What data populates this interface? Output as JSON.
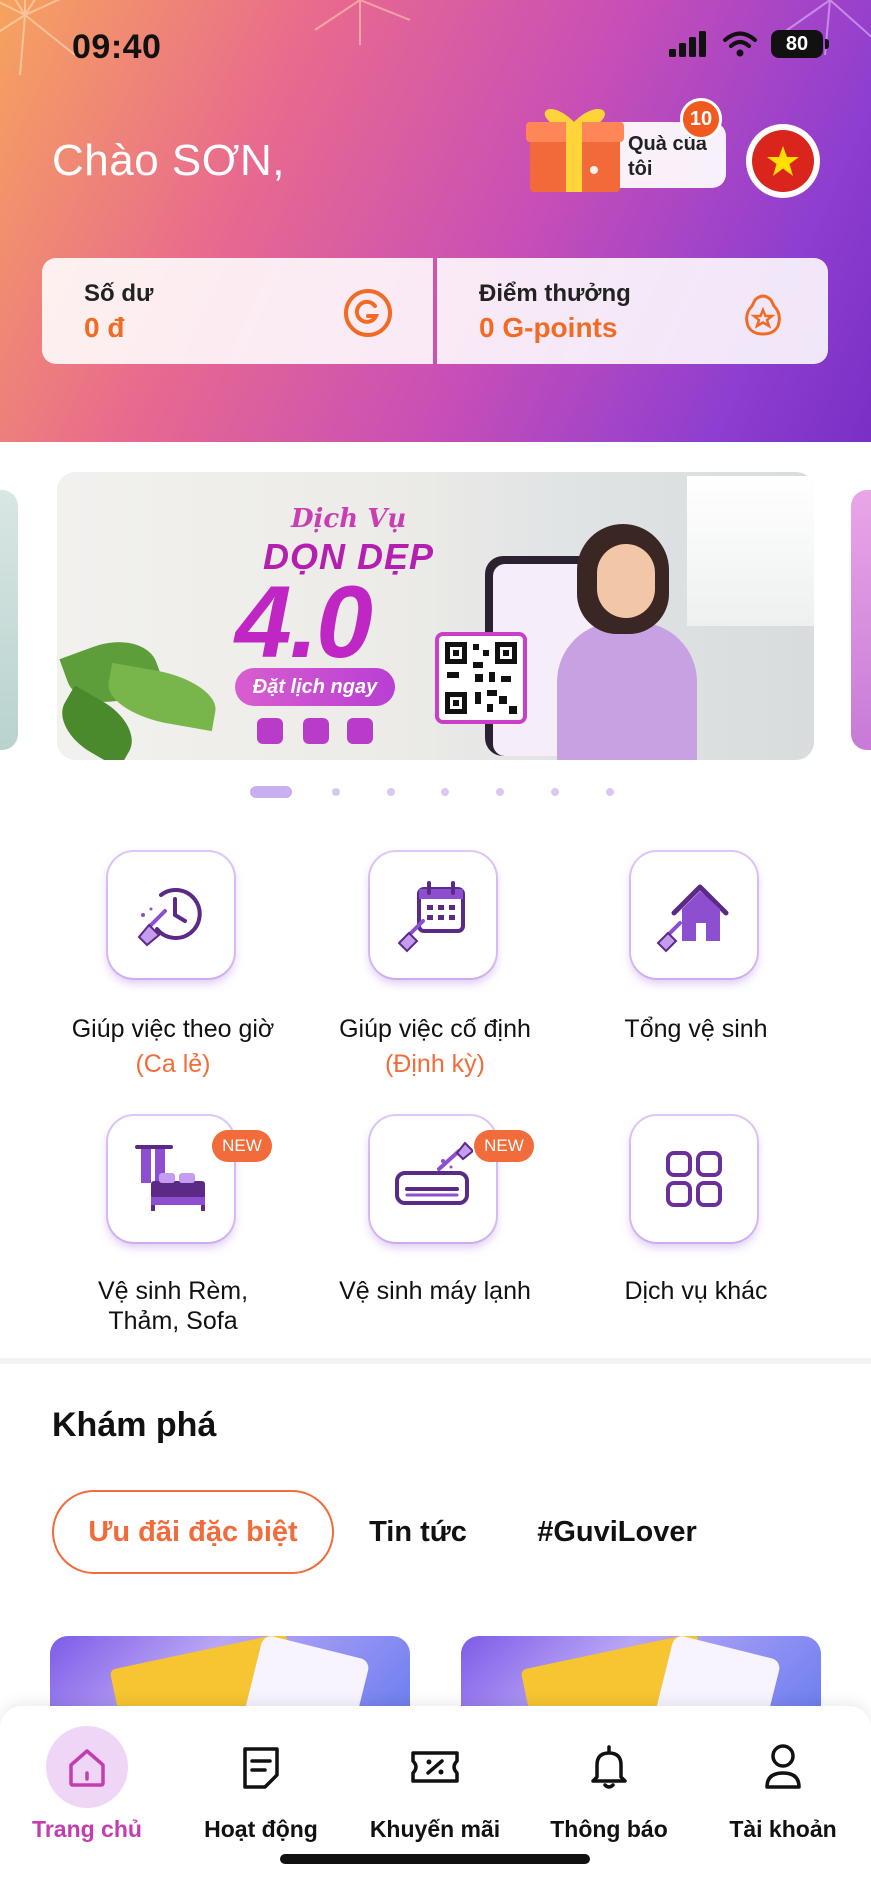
{
  "status_bar": {
    "time": "09:40",
    "battery": "80"
  },
  "header": {
    "greeting": "Chào SƠN,",
    "gift": {
      "label": "Quà của tôi",
      "badge": "10"
    },
    "flag_icon": "vietnam-flag-icon"
  },
  "wallet": {
    "balance": {
      "title": "Số dư",
      "value": "0 đ",
      "icon": "g-coin-icon"
    },
    "points": {
      "title": "Điểm thưởng",
      "value": "0 G-points",
      "icon": "points-bag-icon"
    }
  },
  "banner": {
    "subtitle": "Dịch Vụ",
    "title": "DỌN DẸP",
    "version": "4.0",
    "cta": "Đặt lịch ngay",
    "slide_count": 7,
    "active_slide": 1
  },
  "services": [
    {
      "label": "Giúp việc theo giờ",
      "sub": "(Ca lẻ)",
      "icon": "clock-broom-icon",
      "badge": ""
    },
    {
      "label": "Giúp việc cố định",
      "sub": "(Định kỳ)",
      "icon": "calendar-broom-icon",
      "badge": ""
    },
    {
      "label": "Tổng vệ sinh",
      "sub": "",
      "icon": "house-broom-icon",
      "badge": ""
    },
    {
      "label": "Vệ sinh Rèm, Thảm, Sofa",
      "sub": "",
      "icon": "curtain-bed-icon",
      "badge": "NEW"
    },
    {
      "label": "Vệ sinh máy lạnh",
      "sub": "",
      "icon": "air-conditioner-icon",
      "badge": "NEW"
    },
    {
      "label": "Dịch vụ khác",
      "sub": "",
      "icon": "grid-icon",
      "badge": ""
    }
  ],
  "explore": {
    "title": "Khám phá",
    "tabs": [
      {
        "label": "Ưu đãi đặc biệt",
        "active": true
      },
      {
        "label": "Tin tức",
        "active": false
      },
      {
        "label": "#GuviLover",
        "active": false
      }
    ]
  },
  "bottom_nav": [
    {
      "label": "Trang chủ",
      "icon": "home-icon",
      "active": true
    },
    {
      "label": "Hoạt động",
      "icon": "activity-note-icon",
      "active": false
    },
    {
      "label": "Khuyến mãi",
      "icon": "coupon-icon",
      "active": false
    },
    {
      "label": "Thông báo",
      "icon": "bell-icon",
      "active": false
    },
    {
      "label": "Tài khoản",
      "icon": "user-icon",
      "active": false
    }
  ],
  "colors": {
    "accent_orange": "#f26b3a",
    "accent_purple": "#c33db1",
    "header_gradient_start": "#f6a35e",
    "header_gradient_end": "#7a2fc4"
  }
}
